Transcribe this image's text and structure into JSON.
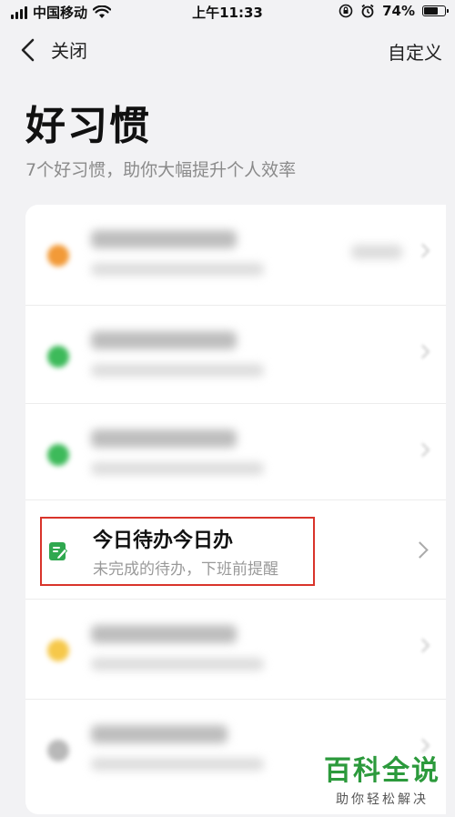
{
  "status_bar": {
    "carrier": "中国移动",
    "time": "上午11:33",
    "battery_percent": "74%",
    "battery_level": 0.74
  },
  "nav": {
    "back_label": "关闭",
    "right_label": "自定义"
  },
  "header": {
    "title": "好习惯",
    "subtitle": "7个好习惯，助你大幅提升个人效率"
  },
  "highlighted_item": {
    "title": "今日待办今日办",
    "subtitle": "未完成的待办，下班前提醒",
    "icon": "note-edit-icon",
    "icon_color": "#2fa84f",
    "highlight_color": "#d9342b"
  },
  "blurred_item_colors": [
    "#f29a38",
    "#3dba5a",
    "#3dba5a",
    "#f6c84a",
    "#b8b8b8"
  ],
  "watermark": {
    "main": "百科全说",
    "sub": "助你轻松解决",
    "color": "#2c9a3c"
  }
}
